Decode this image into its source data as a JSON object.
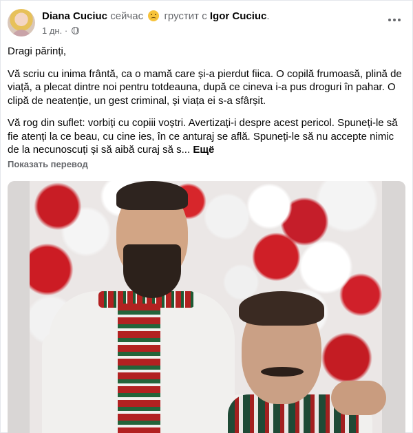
{
  "post": {
    "author_name": "Diana Cuciuc",
    "status_time_word": "сейчас",
    "feeling_label": "грустит с",
    "feeling_icon": "sad-face-emoji",
    "tagged_name": "Igor Cuciuc",
    "tagged_suffix": ".",
    "time_ago": "1 дн.",
    "meta_separator": "·",
    "audience_icon": "globe-icon",
    "more_icon": "more-dots-icon",
    "greeting": "Dragi părinți,",
    "paragraph_1": "Vă scriu cu inima frântă, ca o mamă care și-a pierdut fiica. O copilă frumoasă, plină de viață, a plecat dintre noi pentru totdeauna, după ce cineva i-a pus droguri în pahar. O clipă de neatenție, un gest criminal, și viața ei s-a sfârșit.",
    "paragraph_2": "Vă rog din suflet: vorbiți cu copiii voștri. Avertizați-i despre acest pericol. Spuneți-le să fie atenți la ce beau, cu cine ies, în ce anturaj se află. Spuneți-le să nu accepte nimic de la necunoscuți și să aibă curaj să s...",
    "see_more": "Ещё",
    "translate_label": "Показать перевод"
  },
  "colors": {
    "text_primary": "#050505",
    "text_secondary": "#65676b",
    "border": "#e4e6eb"
  }
}
